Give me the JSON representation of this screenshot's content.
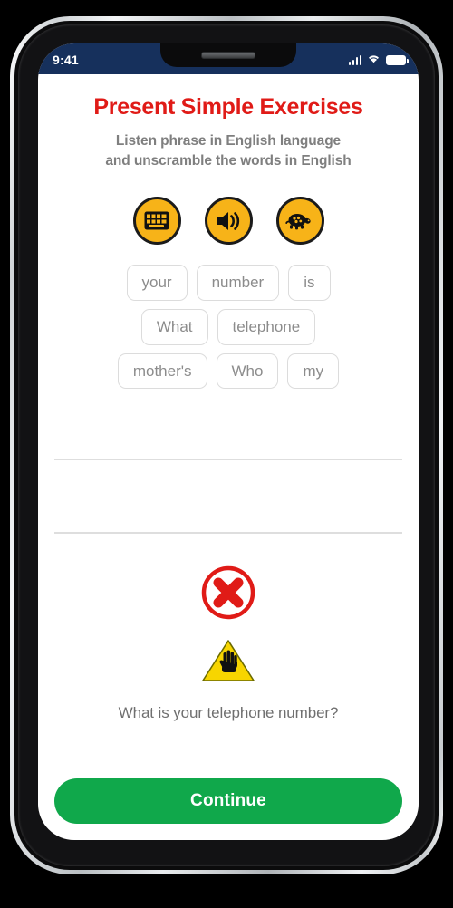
{
  "device": {
    "status_bar": {
      "time": "9:41",
      "signal_icon": "cellular-signal-icon",
      "wifi_icon": "wifi-icon",
      "battery_icon": "battery-full-icon",
      "background_color": "#16305c"
    },
    "notch_icon": "earpiece-speaker-grille"
  },
  "screen": {
    "title": "Present Simple Exercises",
    "title_color": "#e01b17",
    "subtitle_line1": "Listen phrase in English language",
    "subtitle_line2": "and unscramble the words in English",
    "subtitle_color": "#7f7f7f"
  },
  "audio_controls": {
    "accent_color": "#f7b318",
    "buttons": [
      {
        "icon": "keyboard-icon",
        "label": "Keyboard"
      },
      {
        "icon": "speaker-volume-icon",
        "label": "Play audio"
      },
      {
        "icon": "turtle-icon",
        "label": "Play slowly"
      }
    ]
  },
  "word_bank": {
    "rows": [
      [
        "your",
        "number",
        "is"
      ],
      [
        "What",
        "telephone"
      ],
      [
        "mother's",
        "Who",
        "my"
      ]
    ]
  },
  "answer_slots": {
    "line1": "",
    "line2": ""
  },
  "feedback": {
    "result_icon": "cross-mark-icon",
    "result_color": "#e01b17",
    "warning_icon": "warning-triangle-hand-icon",
    "warning_color": "#f7d000",
    "correct_answer": "What is your telephone number?"
  },
  "footer": {
    "continue_label": "Continue",
    "continue_color": "#10a84b"
  }
}
